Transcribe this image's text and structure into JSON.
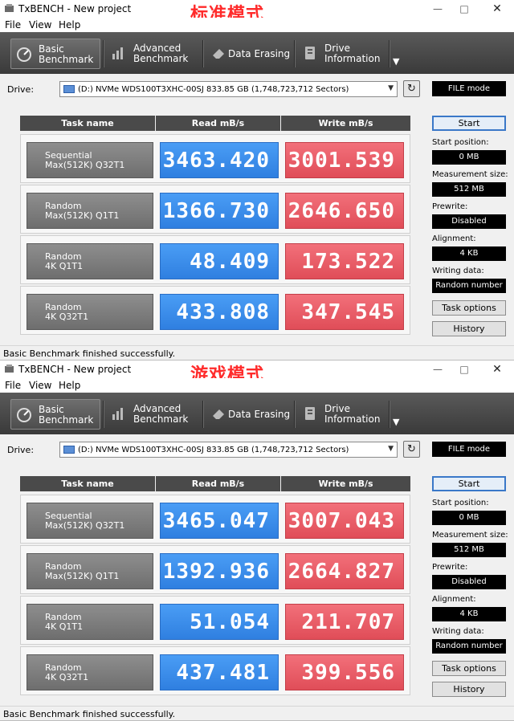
{
  "windows": [
    {
      "title": "TxBENCH - New project",
      "mode_label": "标准模式",
      "menu": [
        "File",
        "View",
        "Help"
      ],
      "toolbar": [
        {
          "line1": "Basic",
          "line2": "Benchmark"
        },
        {
          "line1": "Advanced",
          "line2": "Benchmark"
        },
        {
          "line1": "Data Erasing",
          "line2": ""
        },
        {
          "line1": "Drive",
          "line2": "Information"
        }
      ],
      "drive_label": "Drive:",
      "drive_value": "(D:) NVMe WDS100T3XHC-00SJ  833.85 GB (1,748,723,712 Sectors)",
      "mode_box": "FILE mode",
      "headers": {
        "task": "Task name",
        "read": "Read mB/s",
        "write": "Write mB/s"
      },
      "rows": [
        {
          "task1": "Sequential",
          "task2": "Max(512K) Q32T1",
          "read": "3463.420",
          "write": "3001.539"
        },
        {
          "task1": "Random",
          "task2": "Max(512K) Q1T1",
          "read": "1366.730",
          "write": "2646.650"
        },
        {
          "task1": "Random",
          "task2": "4K Q1T1",
          "read": "48.409",
          "write": "173.522"
        },
        {
          "task1": "Random",
          "task2": "4K Q32T1",
          "read": "433.808",
          "write": "347.545"
        }
      ],
      "side": {
        "start": "Start",
        "start_position_label": "Start position:",
        "start_position": "0 MB",
        "measurement_size_label": "Measurement size:",
        "measurement_size": "512 MB",
        "prewrite_label": "Prewrite:",
        "prewrite": "Disabled",
        "alignment_label": "Alignment:",
        "alignment": "4 KB",
        "writing_data_label": "Writing data:",
        "writing_data": "Random number",
        "task_options": "Task options",
        "history": "History"
      },
      "status": "Basic Benchmark finished successfully."
    },
    {
      "title": "TxBENCH - New project",
      "mode_label": "游戏模式",
      "menu": [
        "File",
        "View",
        "Help"
      ],
      "toolbar": [
        {
          "line1": "Basic",
          "line2": "Benchmark"
        },
        {
          "line1": "Advanced",
          "line2": "Benchmark"
        },
        {
          "line1": "Data Erasing",
          "line2": ""
        },
        {
          "line1": "Drive",
          "line2": "Information"
        }
      ],
      "drive_label": "Drive:",
      "drive_value": "(D:) NVMe WDS100T3XHC-00SJ  833.85 GB (1,748,723,712 Sectors)",
      "mode_box": "FILE mode",
      "headers": {
        "task": "Task name",
        "read": "Read mB/s",
        "write": "Write mB/s"
      },
      "rows": [
        {
          "task1": "Sequential",
          "task2": "Max(512K) Q32T1",
          "read": "3465.047",
          "write": "3007.043"
        },
        {
          "task1": "Random",
          "task2": "Max(512K) Q1T1",
          "read": "1392.936",
          "write": "2664.827"
        },
        {
          "task1": "Random",
          "task2": "4K Q1T1",
          "read": "51.054",
          "write": "211.707"
        },
        {
          "task1": "Random",
          "task2": "4K Q32T1",
          "read": "437.481",
          "write": "399.556"
        }
      ],
      "side": {
        "start": "Start",
        "start_position_label": "Start position:",
        "start_position": "0 MB",
        "measurement_size_label": "Measurement size:",
        "measurement_size": "512 MB",
        "prewrite_label": "Prewrite:",
        "prewrite": "Disabled",
        "alignment_label": "Alignment:",
        "alignment": "4 KB",
        "writing_data_label": "Writing data:",
        "writing_data": "Random number",
        "task_options": "Task options",
        "history": "History"
      },
      "status": "Basic Benchmark finished successfully."
    }
  ],
  "colors": {
    "read": "#3a8cee",
    "write": "#e85a64",
    "mode_label": "#ff2b2b",
    "toolbar": "#4a4a4a"
  }
}
